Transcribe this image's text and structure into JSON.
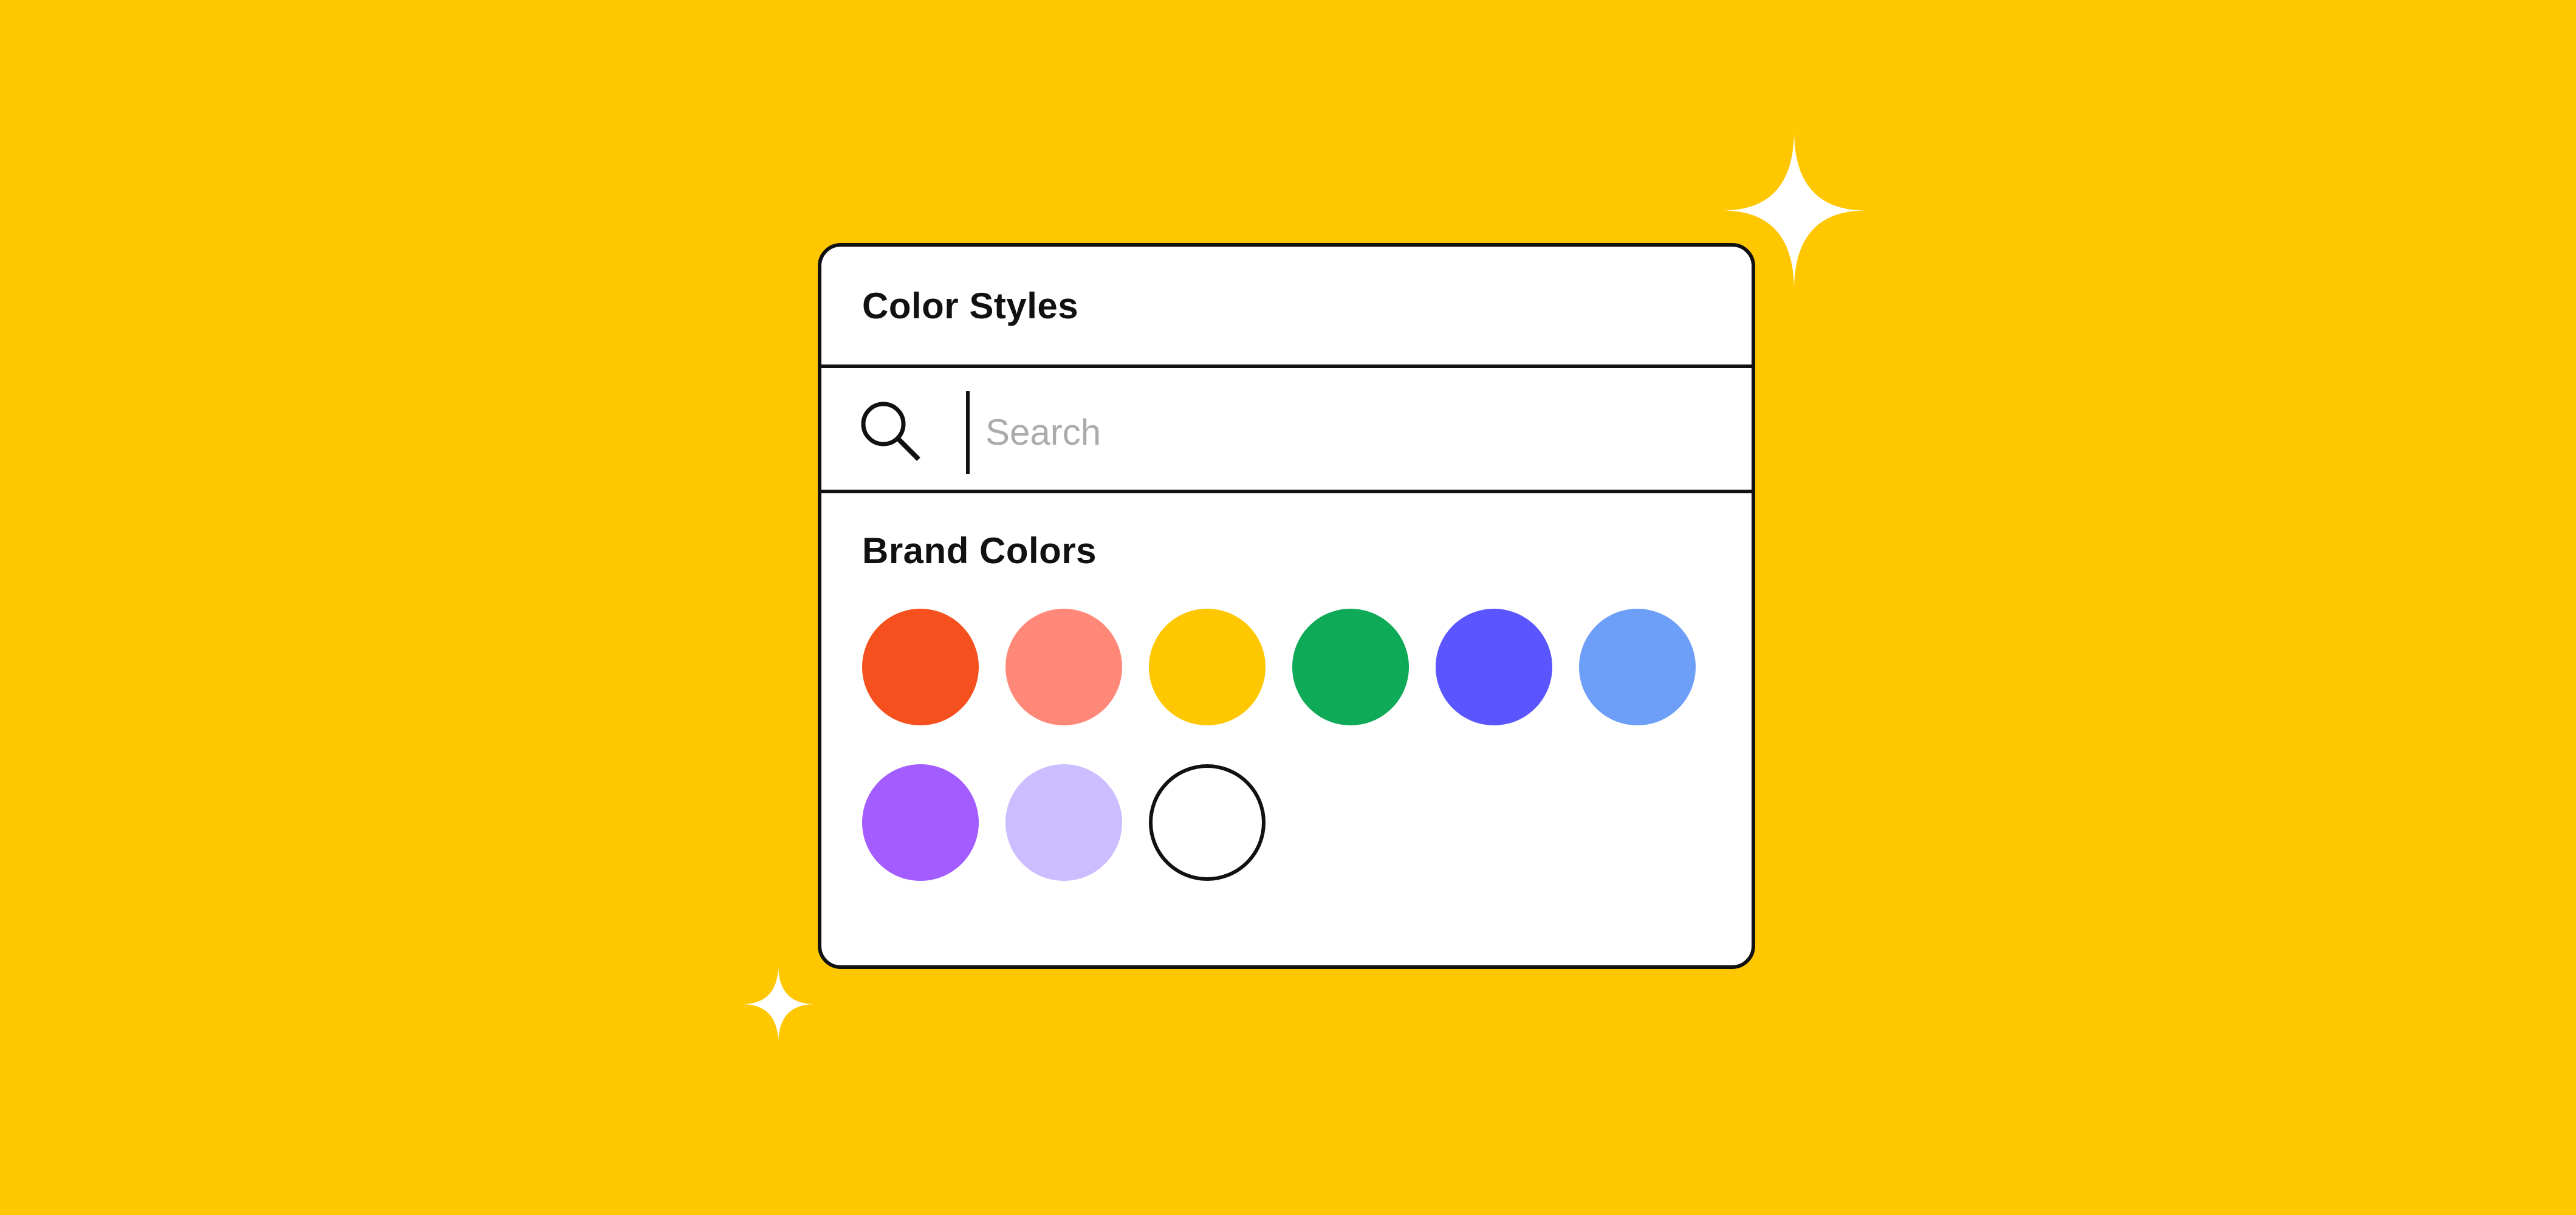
{
  "panel": {
    "title": "Color Styles"
  },
  "search": {
    "placeholder": "Search",
    "value": "",
    "icon": "search-icon"
  },
  "section": {
    "title": "Brand Colors"
  },
  "swatches": [
    {
      "color": "#F5501E"
    },
    {
      "color": "#FF8878"
    },
    {
      "color": "#FFC700"
    },
    {
      "color": "#0FAA58"
    },
    {
      "color": "#5A55FF"
    },
    {
      "color": "#6D9EF8"
    },
    {
      "color": "#A35CFF"
    },
    {
      "color": "#CBBDFF"
    },
    {
      "color": "#FFFFFF",
      "outlined": true
    }
  ],
  "decorations": {
    "sparkle_color": "#FFFFFF",
    "background_color": "#FFC700"
  }
}
